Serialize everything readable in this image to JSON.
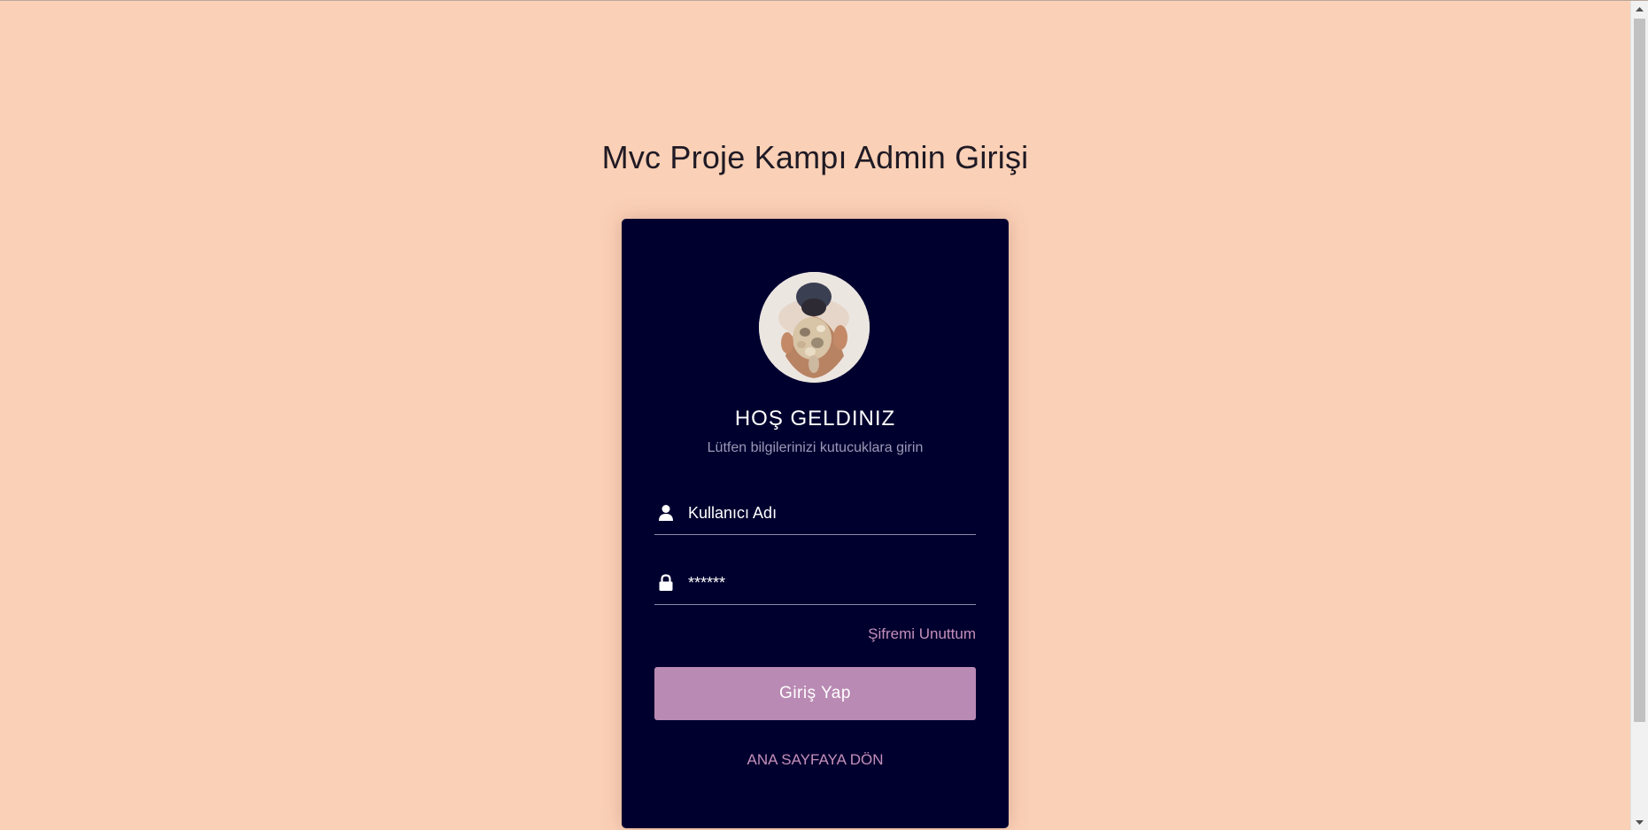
{
  "page": {
    "title": "Mvc Proje Kampı Admin Girişi"
  },
  "login": {
    "avatar_icon": "user-photo",
    "welcome": "HOŞ GELDINIZ",
    "subtitle": "Lütfen bilgilerinizi kutucuklara girin",
    "username": {
      "icon": "user-icon",
      "placeholder": "Kullanıcı Adı",
      "value": ""
    },
    "password": {
      "icon": "lock-icon",
      "placeholder": "******",
      "value": ""
    },
    "forgot_label": "Şifremi Unuttum",
    "submit_label": "Giriş Yap",
    "home_label": "ANA SAYFAYA DÖN"
  },
  "colors": {
    "background": "#fad0b6",
    "card": "#00002f",
    "accent": "#b98ab3",
    "link": "#c58fb8"
  }
}
